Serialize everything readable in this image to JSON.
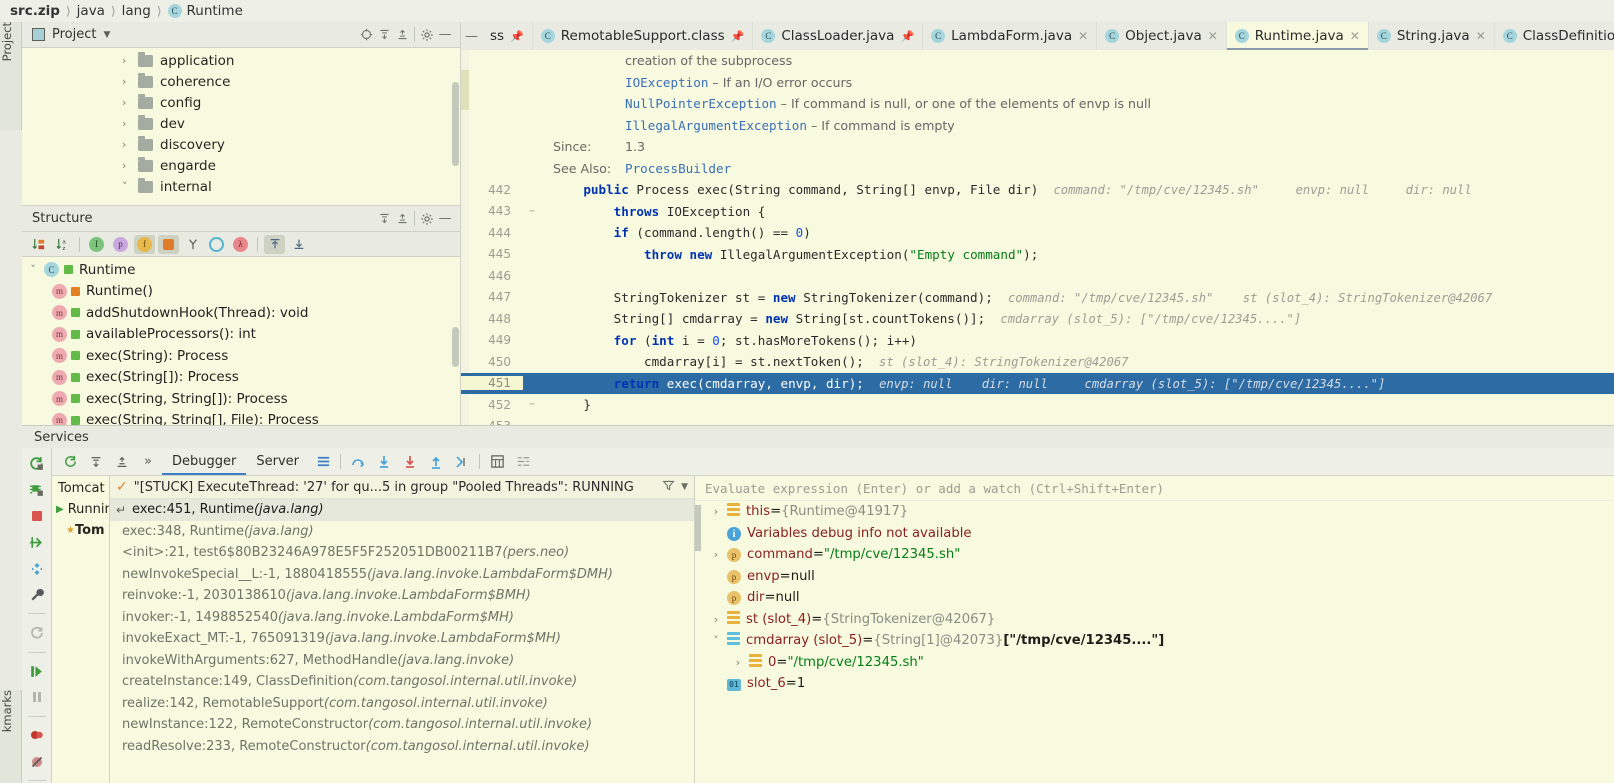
{
  "breadcrumb": {
    "items": [
      "src.zip",
      "java",
      "lang",
      "Runtime"
    ]
  },
  "project_panel": {
    "title": "Project",
    "icons": [
      "locate-icon",
      "expand-all-icon",
      "collapse-all-icon",
      "gear-icon",
      "minimize-icon"
    ],
    "tree": [
      {
        "label": "application",
        "expanded": false
      },
      {
        "label": "coherence",
        "expanded": false
      },
      {
        "label": "config",
        "expanded": false
      },
      {
        "label": "dev",
        "expanded": false
      },
      {
        "label": "discovery",
        "expanded": false
      },
      {
        "label": "engarde",
        "expanded": false
      },
      {
        "label": "internal",
        "expanded": true
      }
    ]
  },
  "structure_panel": {
    "title": "Structure",
    "icons": [
      "expand-all-icon",
      "collapse-all-icon",
      "gear-icon",
      "minimize-icon"
    ],
    "toolbar": [
      "sort-by-visibility-icon",
      "sort-alphabetically-icon",
      "show-inherited-icon",
      "show-properties-icon",
      "show-fields-icon",
      "show-non-public-icon",
      "group-methods-icon",
      "show-anonymous-icon",
      "show-lambdas-icon",
      "scroll-from-source-icon",
      "scroll-to-source-icon"
    ],
    "tree": [
      {
        "label": "Runtime",
        "kind": "class",
        "access": "public"
      },
      {
        "label": "Runtime()",
        "kind": "method",
        "access": "private"
      },
      {
        "label": "addShutdownHook(Thread): void",
        "kind": "method",
        "access": "public"
      },
      {
        "label": "availableProcessors(): int",
        "kind": "method",
        "access": "public"
      },
      {
        "label": "exec(String): Process",
        "kind": "method",
        "access": "public"
      },
      {
        "label": "exec(String[]): Process",
        "kind": "method",
        "access": "public"
      },
      {
        "label": "exec(String, String[]): Process",
        "kind": "method",
        "access": "public"
      },
      {
        "label": "exec(String, String[], File): Process",
        "kind": "method",
        "access": "public"
      }
    ]
  },
  "editor": {
    "tabs": [
      {
        "label": "ss",
        "truncated": true,
        "pinned": true,
        "active": false
      },
      {
        "label": "RemotableSupport.class",
        "pinned": true,
        "active": false
      },
      {
        "label": "ClassLoader.java",
        "pinned": true,
        "active": false
      },
      {
        "label": "LambdaForm.java",
        "pinned": false,
        "active": false
      },
      {
        "label": "Object.java",
        "pinned": false,
        "active": false
      },
      {
        "label": "Runtime.java",
        "pinned": false,
        "active": true
      },
      {
        "label": "String.java",
        "pinned": false,
        "active": false
      },
      {
        "label": "ClassDefinition.class",
        "pinned": false,
        "active": false
      }
    ],
    "javadoc": [
      {
        "indent": 3,
        "parts": [
          {
            "t": "creation of the subprocess",
            "c": "doc"
          }
        ]
      },
      {
        "indent": 3,
        "parts": [
          {
            "t": "IOException",
            "c": "doclink"
          },
          {
            "t": " – If an I/O error occurs",
            "c": "doc"
          }
        ]
      },
      {
        "indent": 3,
        "parts": [
          {
            "t": "NullPointerException",
            "c": "doclink"
          },
          {
            "t": " – If command is null, or one of the elements of envp is null",
            "c": "doc"
          }
        ]
      },
      {
        "indent": 3,
        "parts": [
          {
            "t": "IllegalArgumentException",
            "c": "doclink"
          },
          {
            "t": " – If command is empty",
            "c": "doc"
          }
        ]
      },
      {
        "indent": 0,
        "label": "Since:",
        "parts": [
          {
            "t": "1.3",
            "c": "doc"
          }
        ]
      },
      {
        "indent": 0,
        "label": "See Also:",
        "parts": [
          {
            "t": "ProcessBuilder",
            "c": "doclink"
          }
        ]
      }
    ],
    "lines": [
      {
        "num": "442",
        "fold": "",
        "code": "    public Process exec(String command, String[] envp, File dir)",
        "hint": "command: \"/tmp/cve/12345.sh\"     envp: null     dir: null",
        "current": false
      },
      {
        "num": "443",
        "fold": "−",
        "code": "        throws IOException {",
        "hint": "",
        "current": false
      },
      {
        "num": "444",
        "fold": "",
        "code": "        if (command.length() == 0)",
        "hint": "",
        "current": false
      },
      {
        "num": "445",
        "fold": "",
        "code": "            throw new IllegalArgumentException(\"Empty command\");",
        "hint": "",
        "current": false
      },
      {
        "num": "446",
        "fold": "",
        "code": "",
        "hint": "",
        "current": false
      },
      {
        "num": "447",
        "fold": "",
        "code": "        StringTokenizer st = new StringTokenizer(command);",
        "hint": "command: \"/tmp/cve/12345.sh\"    st (slot_4): StringTokenizer@42067",
        "current": false
      },
      {
        "num": "448",
        "fold": "",
        "code": "        String[] cmdarray = new String[st.countTokens()];",
        "hint": "cmdarray (slot_5): [\"/tmp/cve/12345....\"]",
        "current": false
      },
      {
        "num": "449",
        "fold": "",
        "code": "        for (int i = 0; st.hasMoreTokens(); i++)",
        "hint": "",
        "current": false
      },
      {
        "num": "450",
        "fold": "",
        "code": "            cmdarray[i] = st.nextToken();",
        "hint": "st (slot_4): StringTokenizer@42067",
        "current": false
      },
      {
        "num": "451",
        "fold": "",
        "code": "        return exec(cmdarray, envp, dir);",
        "hint": "envp: null    dir: null     cmdarray (slot_5): [\"/tmp/cve/12345....\"]",
        "current": true
      },
      {
        "num": "452",
        "fold": "−",
        "code": "    }",
        "hint": "",
        "current": false
      },
      {
        "num": "453",
        "fold": "",
        "code": "",
        "hint": "",
        "current": false
      }
    ]
  },
  "services": {
    "title": "Services",
    "toolbar_icons": [
      "rerun-icon",
      "expand-all-icon",
      "collapse-all-icon",
      "more-icon"
    ],
    "tabs": [
      {
        "label": "Debugger",
        "active": true
      },
      {
        "label": "Server",
        "active": false
      }
    ],
    "action_icons": [
      "console-icon",
      "step-over-icon",
      "step-into-icon",
      "force-step-into-icon",
      "step-out-icon",
      "run-to-cursor-icon",
      "evaluate-icon",
      "mute-breakpoints-icon"
    ],
    "vertical_icons": [
      "rerun-icon",
      "rerun-debug-icon",
      "stop-icon",
      "resume-icon",
      "settings-dots-icon",
      "wrench-icon",
      "restart-icon",
      "resume-program-icon",
      "pause-icon",
      "breakpoints-icon",
      "mute-breakpoints-icon"
    ],
    "tree": [
      {
        "label": "Tomcat S",
        "kind": "root"
      },
      {
        "label": "Running",
        "kind": "group"
      },
      {
        "label": "Tom",
        "kind": "item"
      }
    ],
    "thread": {
      "label": "\"[STUCK] ExecuteThread: '27' for qu...5 in group \"Pooled Threads\": RUNNING",
      "status_icon": "check-icon",
      "filter_icon": "filter-icon",
      "dropdown_icon": "chevron-down-icon"
    },
    "frames": [
      {
        "label": "exec:451, Runtime",
        "pkg": "(java.lang)",
        "selected": true
      },
      {
        "label": "exec:348, Runtime",
        "pkg": "(java.lang)",
        "selected": false
      },
      {
        "label": "<init>:21, test6$80B23246A978E5F5F252051DB00211B7",
        "pkg": "(pers.neo)",
        "selected": false
      },
      {
        "label": "newInvokeSpecial__L:-1, 1880418555",
        "pkg": "(java.lang.invoke.LambdaForm$DMH)",
        "selected": false
      },
      {
        "label": "reinvoke:-1, 2030138610",
        "pkg": "(java.lang.invoke.LambdaForm$BMH)",
        "selected": false
      },
      {
        "label": "invoker:-1, 1498852540",
        "pkg": "(java.lang.invoke.LambdaForm$MH)",
        "selected": false
      },
      {
        "label": "invokeExact_MT:-1, 765091319",
        "pkg": "(java.lang.invoke.LambdaForm$MH)",
        "selected": false
      },
      {
        "label": "invokeWithArguments:627, MethodHandle",
        "pkg": "(java.lang.invoke)",
        "selected": false
      },
      {
        "label": "createInstance:149, ClassDefinition",
        "pkg": "(com.tangosol.internal.util.invoke)",
        "selected": false
      },
      {
        "label": "realize:142, RemotableSupport",
        "pkg": "(com.tangosol.internal.util.invoke)",
        "selected": false
      },
      {
        "label": "newInstance:122, RemoteConstructor",
        "pkg": "(com.tangosol.internal.util.invoke)",
        "selected": false
      },
      {
        "label": "readResolve:233, RemoteConstructor",
        "pkg": "(com.tangosol.internal.util.invoke)",
        "selected": false
      }
    ],
    "watch_placeholder": "Evaluate expression (Enter) or add a watch (Ctrl+Shift+Enter)",
    "variables": [
      {
        "indent": 0,
        "twisty": "›",
        "icon": "field-icon",
        "name": "this",
        "eq": " = ",
        "value": "{Runtime@41917}",
        "value_class": "vg"
      },
      {
        "indent": 0,
        "twisty": "",
        "icon": "info-icon",
        "name": "Variables debug info not available",
        "eq": "",
        "value": "",
        "value_class": ""
      },
      {
        "indent": 0,
        "twisty": "›",
        "icon": "param-icon",
        "name": "command",
        "eq": " = ",
        "value": "\"/tmp/cve/12345.sh\"",
        "value_class": "vval-str"
      },
      {
        "indent": 0,
        "twisty": "",
        "icon": "param-icon",
        "name": "envp",
        "eq": " = ",
        "value": "null",
        "value_class": "vval-null"
      },
      {
        "indent": 0,
        "twisty": "",
        "icon": "param-icon",
        "name": "dir",
        "eq": " = ",
        "value": "null",
        "value_class": "vval-null"
      },
      {
        "indent": 0,
        "twisty": "›",
        "icon": "field-icon",
        "name": "st (slot_4)",
        "eq": " = ",
        "value": "{StringTokenizer@42067}",
        "value_class": "vg"
      },
      {
        "indent": 0,
        "twisty": "∨",
        "icon": "array-icon",
        "name": "cmdarray (slot_5)",
        "eq": " = ",
        "value": "{String[1]@42073}",
        "value_class": "vg",
        "extra": " [\"/tmp/cve/12345....\"]"
      },
      {
        "indent": 1,
        "twisty": "›",
        "icon": "field-icon",
        "name": "0",
        "eq": " = ",
        "value": "\"/tmp/cve/12345.sh\"",
        "value_class": "vval-str"
      },
      {
        "indent": 0,
        "twisty": "",
        "icon": "primitive-icon",
        "name": "slot_6",
        "eq": " = ",
        "value": "1",
        "value_class": "vval-null"
      }
    ]
  },
  "left_strips": {
    "project": "Project",
    "bookmarks": "kmarks"
  }
}
